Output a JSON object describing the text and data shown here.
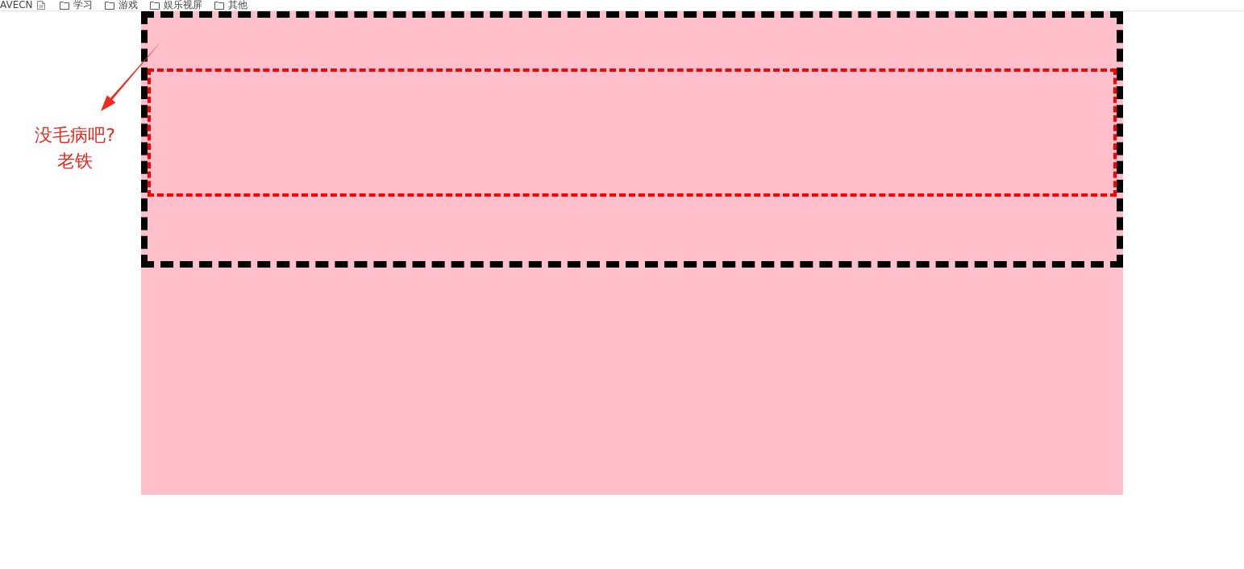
{
  "bookmarks_bar": {
    "items": [
      {
        "kind": "link",
        "label": "AVECN"
      },
      {
        "kind": "favicon"
      },
      {
        "kind": "folder",
        "label": "学习"
      },
      {
        "kind": "folder",
        "label": "游戏"
      },
      {
        "kind": "folder",
        "label": "娱乐视屏"
      },
      {
        "kind": "folder",
        "label": "其他"
      }
    ]
  },
  "demo": {
    "outer_box": {
      "kind": "dashed",
      "inner_box": {
        "kind": "dashed"
      }
    }
  },
  "annotation": {
    "lines": [
      "没毛病吧?",
      "老铁"
    ]
  }
}
